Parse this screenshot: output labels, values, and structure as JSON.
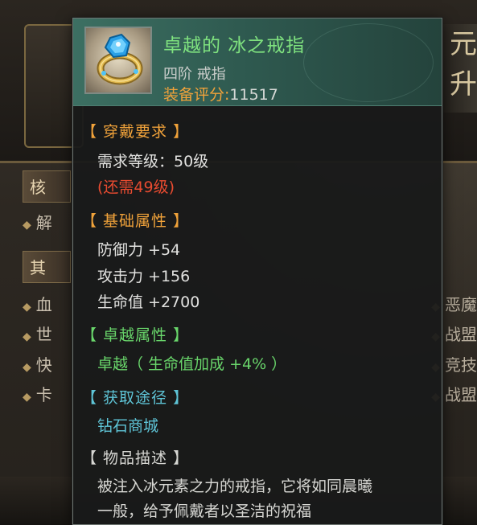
{
  "background": {
    "section_1": "核",
    "section_2": "其",
    "left_rows": [
      "解",
      "血",
      "世",
      "快",
      "卡"
    ],
    "right_rows": [
      "恶魔",
      "战盟",
      "竞技",
      "战盟"
    ],
    "right_title": "元",
    "right_title_2": "升"
  },
  "item": {
    "name": "卓越的 冰之戒指",
    "type": "四阶 戒指",
    "score_label": "装备评分:",
    "score_value": "11517",
    "icon": "ice-ring-icon",
    "name_color": "#7fe27f"
  },
  "requirements": {
    "title": "【 穿戴要求 】",
    "level": "需求等级：50级",
    "remaining": "(还需49级)"
  },
  "base_attributes": {
    "title": "【 基础属性 】",
    "lines": [
      "防御力 +54",
      "攻击力 +156",
      "生命值 +2700"
    ]
  },
  "excellent_attributes": {
    "title": "【 卓越属性 】",
    "lines": [
      "卓越（ 生命值加成 +4% ）"
    ]
  },
  "obtain": {
    "title": "【 获取途径 】",
    "source": "钻石商城"
  },
  "description": {
    "title": "【 物品描述 】",
    "line_1": "被注入冰元素之力的戒指，它将如同晨曦",
    "line_2": "一般，给予佩戴者以圣洁的祝福"
  },
  "colors": {
    "section_orange": "#f0a23a",
    "section_green": "#69d66b",
    "section_cyan": "#5ec4d6",
    "warning_red": "#e84b30",
    "header_teal": "#3c6f62"
  }
}
